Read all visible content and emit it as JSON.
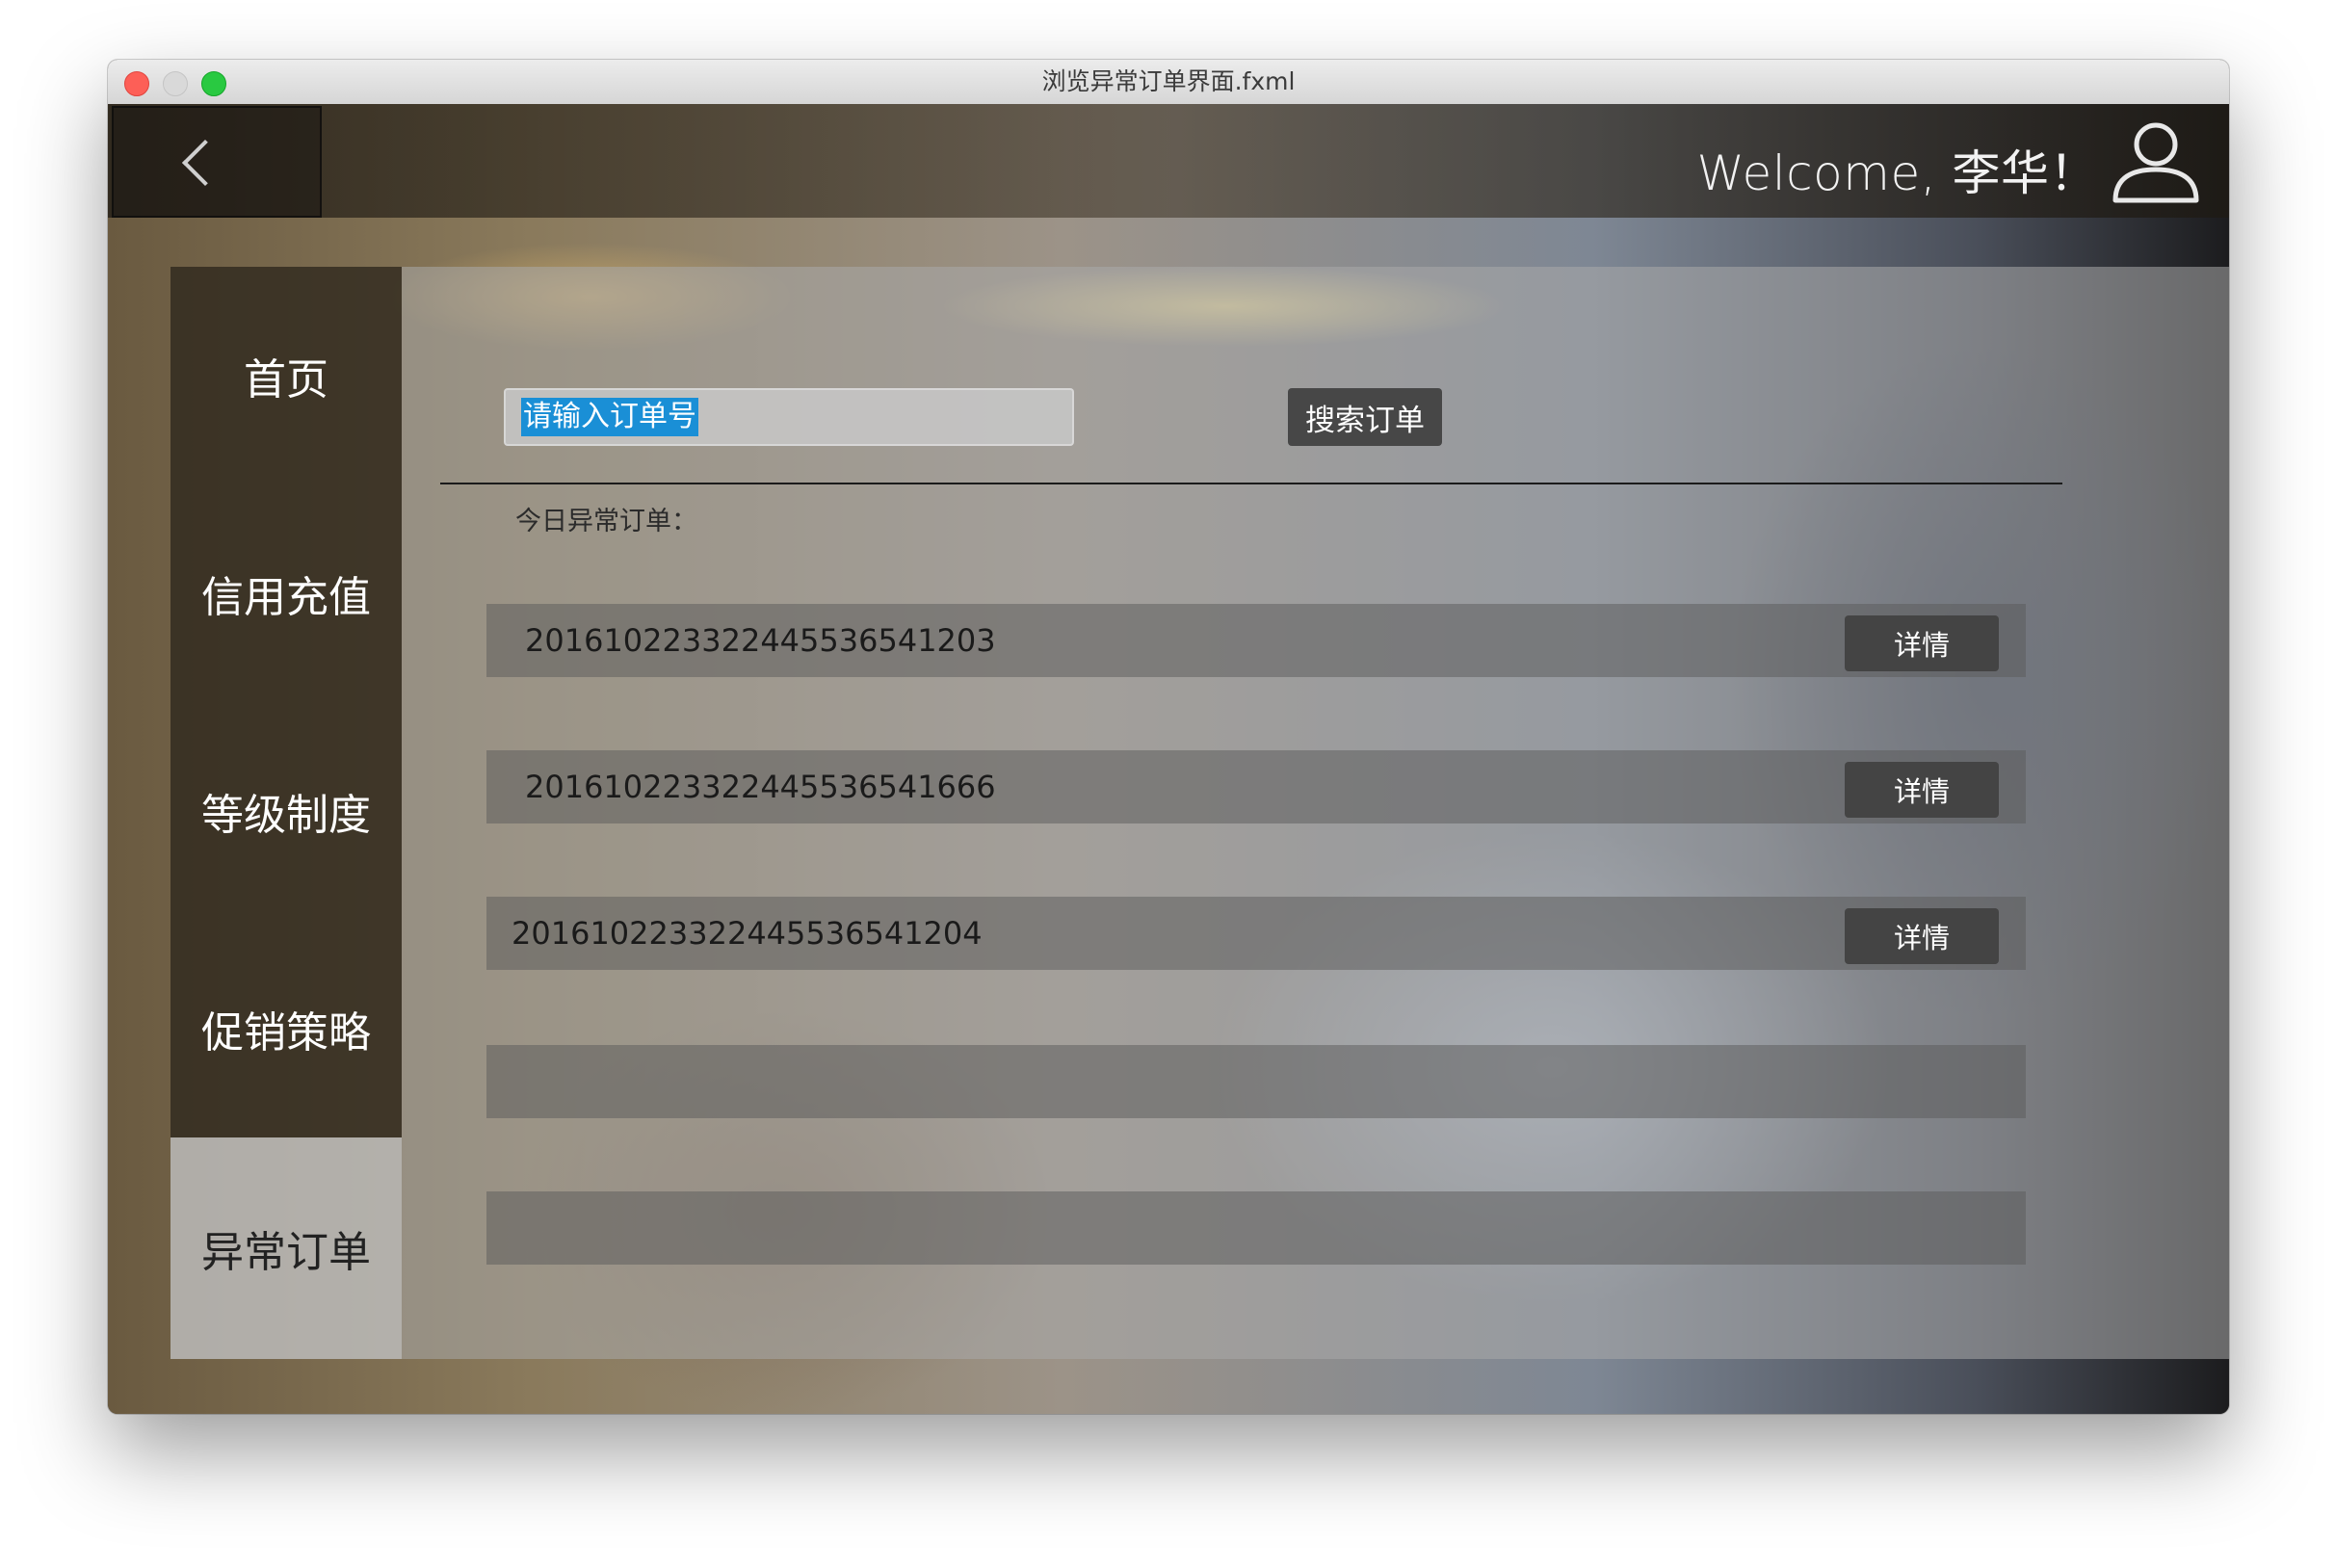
{
  "window": {
    "title": "浏览异常订单界面.fxml"
  },
  "header": {
    "welcome_text": "Welcome, 李华！"
  },
  "sidebar": {
    "items": [
      {
        "label": "首页",
        "active": false
      },
      {
        "label": "信用充值",
        "active": false
      },
      {
        "label": "等级制度",
        "active": false
      },
      {
        "label": "促销策略",
        "active": false
      },
      {
        "label": "异常订单",
        "active": true
      }
    ]
  },
  "search": {
    "placeholder": "请输入订单号",
    "button_label": "搜索订单"
  },
  "orders": {
    "section_label": "今日异常订单：",
    "rows": [
      {
        "order_no": "20161022332244553654​1203",
        "detail_label": "详情"
      },
      {
        "order_no": "201610223322445536541666",
        "detail_label": "详情"
      },
      {
        "order_no": "201610223322445536541204",
        "detail_label": "详情"
      },
      {
        "order_no": "",
        "detail_label": ""
      },
      {
        "order_no": "",
        "detail_label": ""
      }
    ]
  },
  "colors": {
    "nav_bg": "#2d261c",
    "nav_active_bg": "#bebebe",
    "button_bg": "#474747",
    "selection_highlight": "#1a8fd6"
  },
  "icons": {
    "back": "chevron-left-icon",
    "user": "user-icon"
  }
}
